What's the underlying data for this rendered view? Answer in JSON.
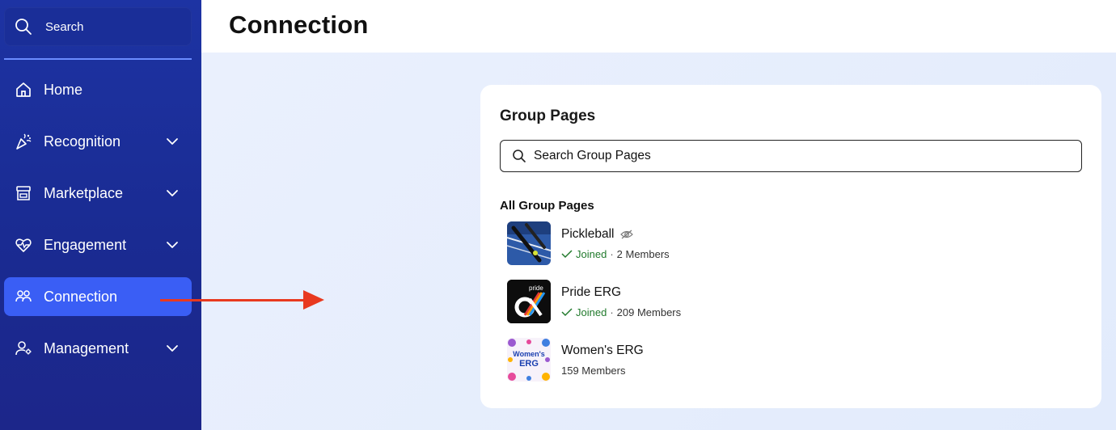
{
  "sidebar": {
    "search_label": "Search",
    "items": [
      {
        "label": "Home",
        "icon": "home-icon",
        "has_chevron": false
      },
      {
        "label": "Recognition",
        "icon": "party-popper-icon",
        "has_chevron": true
      },
      {
        "label": "Marketplace",
        "icon": "storefront-icon",
        "has_chevron": true
      },
      {
        "label": "Engagement",
        "icon": "heartbeat-icon",
        "has_chevron": true
      },
      {
        "label": "Connection",
        "icon": "people-icon",
        "has_chevron": false,
        "active": true
      },
      {
        "label": "Management",
        "icon": "user-gear-icon",
        "has_chevron": true
      }
    ]
  },
  "header": {
    "title": "Connection"
  },
  "group_pages": {
    "title": "Group Pages",
    "search_placeholder": "Search Group Pages",
    "section_label": "All Group Pages",
    "groups": [
      {
        "name": "Pickleball",
        "hidden_icon": "eye-off-icon",
        "joined_label": "Joined",
        "members": "2 Members"
      },
      {
        "name": "Pride ERG",
        "joined_label": "Joined",
        "members": "209 Members",
        "thumb_text": "pride"
      },
      {
        "name": "Women's ERG",
        "members": "159 Members",
        "thumb_text_1": "Women's",
        "thumb_text_2": "ERG"
      }
    ]
  },
  "colors": {
    "sidebar_bg": "#1d33a3",
    "active_item": "#3a5ef5",
    "arrow": "#e8391f",
    "joined_green": "#217a2c"
  }
}
